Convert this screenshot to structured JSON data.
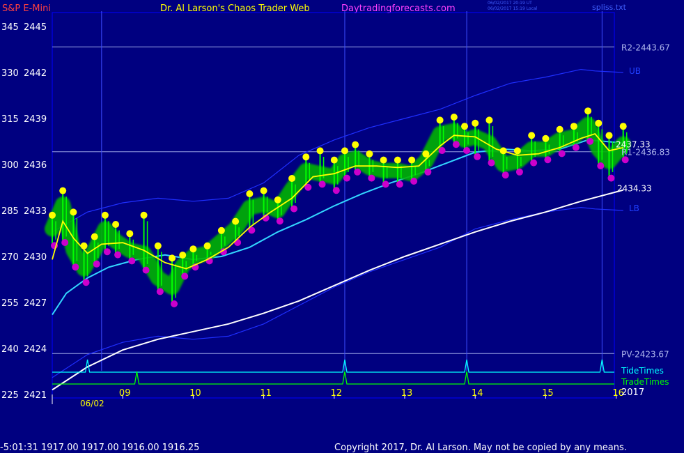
{
  "header": {
    "symbol": "S&P E-Mini",
    "site": "Dr. Al Larson's Chaos Trader Web",
    "link": "Daytradingforecasts.com",
    "utc_time": "06/02/2017 20:19 UT",
    "local_time": "06/02/2017 15:19 Local",
    "file_label": "spliss.txt"
  },
  "footer": {
    "quote": "-5:01:31  1917.00 1917.00 1916.00 1916.25",
    "copyright": "Copyright 2017, Dr. Al Larson. May not be copied by any means."
  },
  "colors": {
    "background": "#000080",
    "frame": "#0000ff",
    "ma_fast": "#ffff00",
    "ma_mid": "#33d6ff",
    "ma_slow": "#ffffff",
    "bands": "#1f2fff",
    "levels": "#9aa4e6",
    "price_bars": "#00ff00",
    "glow": "#00b400",
    "up_dots": "#ffff00",
    "down_dots": "#cc00cc",
    "tide": "#00ffff",
    "trade": "#00ff00"
  },
  "chart_data": {
    "type": "line",
    "title": "S&P E-Mini",
    "date_label": "06/02",
    "year_label": "2017",
    "x_ticks": [
      "09",
      "10",
      "11",
      "12",
      "13",
      "14",
      "15",
      "16"
    ],
    "y_range": [
      2421,
      2446
    ],
    "y_ticks": [
      {
        "left": "345",
        "right": "2445"
      },
      {
        "left": "330",
        "right": "2442"
      },
      {
        "left": "315",
        "right": "2439"
      },
      {
        "left": "300",
        "right": "2436"
      },
      {
        "left": "285",
        "right": "2433"
      },
      {
        "left": "270",
        "right": "2430"
      },
      {
        "left": "255",
        "right": "2427"
      },
      {
        "left": "240",
        "right": "2424"
      },
      {
        "left": "225",
        "right": "2421"
      }
    ],
    "levels": [
      {
        "name": "R2",
        "label": "R2-2443.67",
        "value": 2443.67
      },
      {
        "name": "R1",
        "label": "R1-2436.83",
        "value": 2436.83
      },
      {
        "name": "PV",
        "label": "PV-2423.67",
        "value": 2423.67
      }
    ],
    "band_labels": {
      "upper": "UB",
      "lower": "LB"
    },
    "last_price_label": "2437.33",
    "slow_ma_label": "2434.33",
    "time_lines": [
      8.7,
      12.15,
      13.88,
      15.8
    ],
    "price": {
      "x": [
        8.0,
        8.15,
        8.3,
        8.45,
        8.6,
        8.75,
        8.9,
        9.1,
        9.3,
        9.5,
        9.7,
        9.85,
        10.0,
        10.2,
        10.4,
        10.6,
        10.8,
        11.0,
        11.2,
        11.4,
        11.6,
        11.8,
        12.0,
        12.15,
        12.3,
        12.5,
        12.7,
        12.9,
        13.1,
        13.3,
        13.5,
        13.7,
        13.85,
        14.0,
        14.2,
        14.4,
        14.6,
        14.8,
        15.0,
        15.2,
        15.4,
        15.6,
        15.75,
        15.9,
        16.1
      ],
      "high": [
        2432.6,
        2434.2,
        2432.8,
        2430.6,
        2431.2,
        2432.6,
        2432.0,
        2431.4,
        2432.6,
        2430.6,
        2429.8,
        2430.0,
        2430.4,
        2430.6,
        2431.6,
        2432.2,
        2434.0,
        2434.2,
        2433.6,
        2435.0,
        2436.4,
        2436.8,
        2436.2,
        2436.8,
        2437.2,
        2436.6,
        2436.2,
        2436.2,
        2436.2,
        2436.6,
        2438.8,
        2439.0,
        2438.4,
        2438.6,
        2438.8,
        2436.8,
        2436.8,
        2437.8,
        2437.6,
        2438.2,
        2438.4,
        2439.4,
        2438.6,
        2437.8,
        2438.4
      ],
      "low": [
        2430.8,
        2431.0,
        2429.4,
        2428.4,
        2429.6,
        2430.4,
        2430.2,
        2429.8,
        2429.2,
        2427.8,
        2427.0,
        2428.8,
        2429.4,
        2429.8,
        2430.4,
        2431.0,
        2431.8,
        2432.6,
        2432.4,
        2433.2,
        2434.6,
        2434.8,
        2434.4,
        2435.2,
        2435.6,
        2435.2,
        2434.8,
        2434.8,
        2435.0,
        2435.6,
        2437.0,
        2437.4,
        2437.0,
        2436.6,
        2436.2,
        2435.4,
        2435.6,
        2436.2,
        2436.4,
        2436.8,
        2437.2,
        2437.6,
        2436.0,
        2435.2,
        2436.4
      ],
      "close": [
        2431.8,
        2433.4,
        2430.4,
        2429.2,
        2430.4,
        2431.8,
        2431.0,
        2430.4,
        2430.2,
        2428.6,
        2428.0,
        2429.4,
        2430.0,
        2430.2,
        2431.0,
        2431.8,
        2433.2,
        2433.4,
        2433.0,
        2434.4,
        2435.6,
        2435.4,
        2435.2,
        2436.2,
        2436.4,
        2435.8,
        2435.6,
        2435.6,
        2435.4,
        2436.2,
        2438.0,
        2438.2,
        2437.6,
        2437.8,
        2437.4,
        2436.0,
        2436.2,
        2437.0,
        2437.0,
        2437.6,
        2437.8,
        2438.6,
        2437.0,
        2436.2,
        2437.33
      ]
    },
    "series": [
      {
        "name": "",
        "role": "fast_ma",
        "x": [
          8.0,
          8.15,
          8.3,
          8.5,
          8.7,
          9.0,
          9.3,
          9.6,
          9.9,
          10.2,
          10.5,
          10.8,
          11.1,
          11.4,
          11.7,
          12.0,
          12.3,
          12.6,
          12.9,
          13.2,
          13.5,
          13.7,
          14.0,
          14.3,
          14.6,
          14.9,
          15.2,
          15.5,
          15.7,
          15.9,
          16.1
        ],
        "y": [
          2429.8,
          2432.3,
          2431.2,
          2430.2,
          2430.8,
          2430.9,
          2430.4,
          2429.6,
          2429.2,
          2429.8,
          2430.6,
          2431.9,
          2432.9,
          2433.8,
          2435.2,
          2435.4,
          2435.9,
          2435.9,
          2435.8,
          2435.9,
          2437.2,
          2437.9,
          2437.8,
          2437.0,
          2436.6,
          2436.7,
          2437.1,
          2437.7,
          2438.0,
          2436.9,
          2437.1
        ]
      },
      {
        "name": "",
        "role": "mid_ma",
        "x": [
          8.0,
          8.2,
          8.5,
          8.8,
          9.2,
          9.6,
          10.0,
          10.4,
          10.8,
          11.2,
          11.6,
          12.0,
          12.4,
          12.8,
          13.2,
          13.6,
          14.0,
          14.4,
          14.8,
          15.2,
          15.6,
          16.1
        ],
        "y": [
          2426.2,
          2427.6,
          2428.6,
          2429.3,
          2429.8,
          2430.1,
          2429.8,
          2430.0,
          2430.6,
          2431.6,
          2432.4,
          2433.3,
          2434.1,
          2434.8,
          2435.4,
          2436.1,
          2436.8,
          2437.0,
          2436.9,
          2437.0,
          2437.6,
          2437.4
        ]
      },
      {
        "name": "",
        "role": "slow_ma",
        "x": [
          8.0,
          8.5,
          9.0,
          9.5,
          10.0,
          10.5,
          11.0,
          11.5,
          12.0,
          12.5,
          13.0,
          13.5,
          14.0,
          14.5,
          15.0,
          15.5,
          16.1
        ],
        "y": [
          2421.3,
          2422.8,
          2423.9,
          2424.6,
          2425.1,
          2425.6,
          2426.3,
          2427.1,
          2428.1,
          2429.1,
          2430.0,
          2430.8,
          2431.6,
          2432.3,
          2432.9,
          2433.6,
          2434.33
        ]
      },
      {
        "name": "",
        "role": "upper_band",
        "x": [
          8.0,
          8.5,
          9.0,
          9.5,
          10.0,
          10.5,
          11.0,
          11.5,
          12.0,
          12.5,
          13.0,
          13.5,
          14.0,
          14.5,
          15.0,
          15.5,
          15.7,
          16.1
        ],
        "y": [
          2431.6,
          2432.9,
          2433.5,
          2433.8,
          2433.6,
          2433.8,
          2434.8,
          2436.6,
          2437.6,
          2438.4,
          2439.0,
          2439.6,
          2440.5,
          2441.3,
          2441.7,
          2442.2,
          2442.1,
          2442.0
        ]
      },
      {
        "name": "",
        "role": "lower_band",
        "x": [
          8.0,
          8.5,
          9.0,
          9.5,
          10.0,
          10.5,
          11.0,
          11.5,
          12.0,
          12.5,
          13.0,
          13.5,
          14.0,
          14.5,
          15.0,
          15.5,
          15.7,
          16.1
        ],
        "y": [
          2422.1,
          2423.6,
          2424.4,
          2424.8,
          2424.6,
          2424.8,
          2425.6,
          2426.8,
          2428.0,
          2429.0,
          2429.8,
          2430.6,
          2431.8,
          2432.4,
          2432.9,
          2433.2,
          2433.1,
          2433.0
        ]
      }
    ],
    "tide_times": [
      8.5,
      12.15,
      13.88,
      15.8
    ],
    "trade_times": [
      9.2,
      12.15,
      13.88
    ]
  },
  "legend": {
    "tide": "TideTimes",
    "trade": "TradeTimes"
  }
}
